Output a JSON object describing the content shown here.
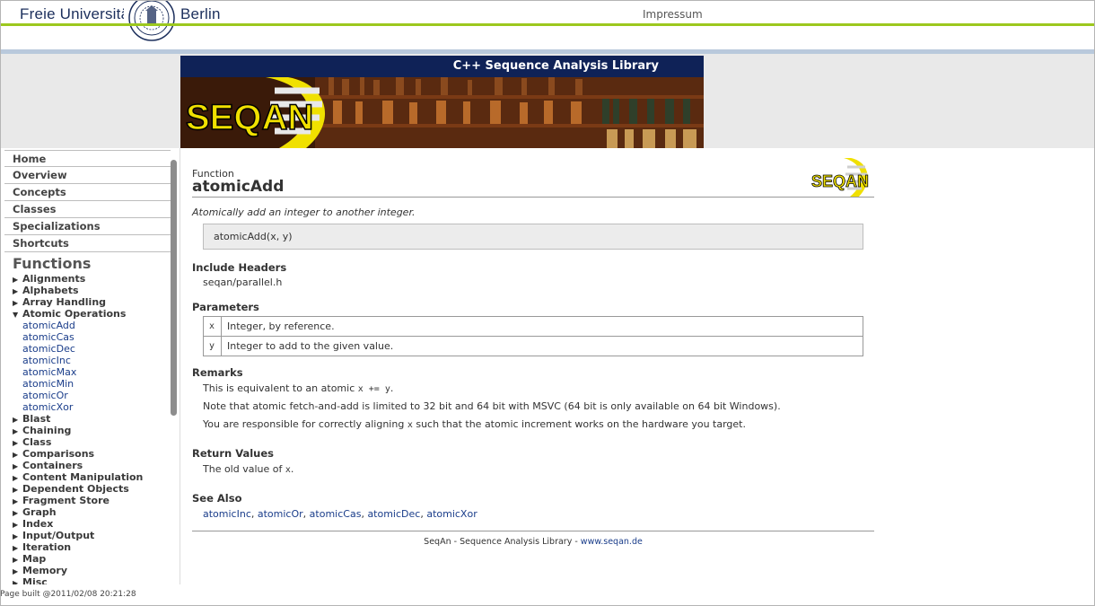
{
  "header": {
    "title_left": "Freie Universität",
    "title_right": "Berlin",
    "impressum": "Impressum"
  },
  "banner": {
    "title": "C++ Sequence Analysis Library",
    "logo_text": "SEQAN"
  },
  "sidebar": {
    "nav": [
      "Home",
      "Overview",
      "Concepts",
      "Classes",
      "Specializations",
      "Shortcuts"
    ],
    "heading": "Functions",
    "groups_before": [
      "Alignments",
      "Alphabets",
      "Array Handling"
    ],
    "expanded_group": "Atomic Operations",
    "expanded_items": [
      "atomicAdd",
      "atomicCas",
      "atomicDec",
      "atomicInc",
      "atomicMax",
      "atomicMin",
      "atomicOr",
      "atomicXor"
    ],
    "groups_after": [
      "Blast",
      "Chaining",
      "Class",
      "Comparisons",
      "Containers",
      "Content Manipulation",
      "Dependent Objects",
      "Fragment Store",
      "Graph",
      "Index",
      "Input/Output",
      "Iteration",
      "Map",
      "Memory",
      "Misc"
    ]
  },
  "page_built": "Page built @2011/02/08 20:21:28",
  "content": {
    "kind": "Function",
    "title": "atomicAdd",
    "logo_text": "SEQAN",
    "summary": "Atomically add an integer to another integer.",
    "signature": "atomicAdd(x, y)",
    "include_heading": "Include Headers",
    "include_file": "seqan/parallel.h",
    "params_heading": "Parameters",
    "params": [
      {
        "name": "x",
        "desc": "Integer, by reference."
      },
      {
        "name": "y",
        "desc": "Integer to add to the given value."
      }
    ],
    "remarks_heading": "Remarks",
    "remark1_prefix": "This is equivalent to an atomic ",
    "remark1_code": "x += y",
    "remark1_suffix": ".",
    "remark2": "Note that atomic fetch-and-add is limited to 32 bit and 64 bit with MSVC (64 bit is only available on 64 bit Windows).",
    "remark3_prefix": "You are responsible for correctly aligning ",
    "remark3_code": "x",
    "remark3_suffix": " such that the atomic increment works on the hardware you target.",
    "return_heading": "Return Values",
    "return_prefix": "The old value of ",
    "return_code": "x",
    "return_suffix": ".",
    "see_heading": "See Also",
    "see_also": [
      "atomicInc",
      "atomicOr",
      "atomicCas",
      "atomicDec",
      "atomicXor"
    ],
    "footer_text": "SeqAn - Sequence Analysis Library - ",
    "footer_link": "www.seqan.de"
  },
  "colors": {
    "accent_green": "#9cc81e",
    "banner_blue": "#0f2257",
    "link_blue": "#1a3d8a",
    "logo_yellow": "#f0e000"
  }
}
